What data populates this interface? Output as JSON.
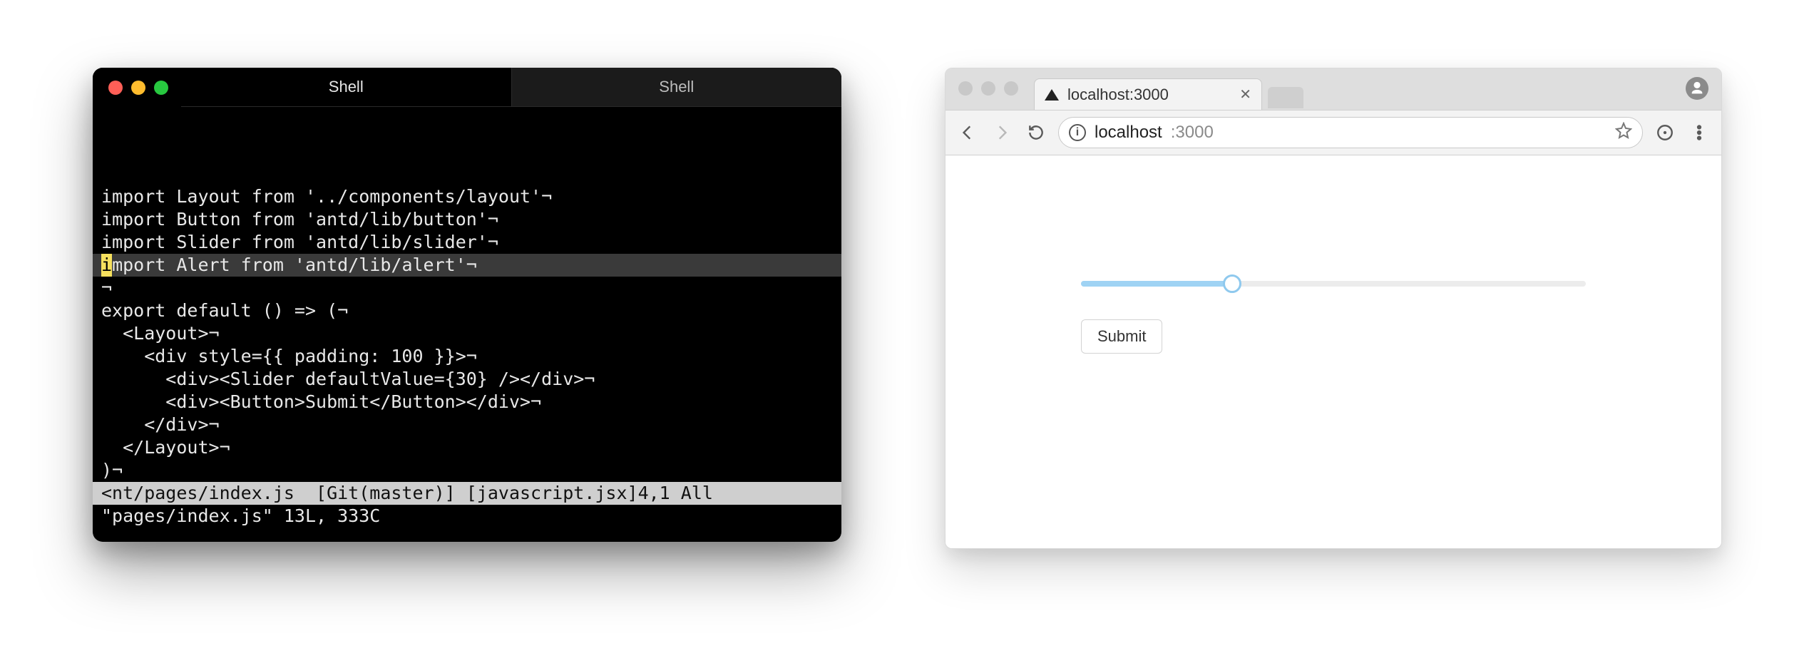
{
  "terminal": {
    "tabs": [
      {
        "label": "Shell",
        "active": true
      },
      {
        "label": "Shell",
        "active": false
      }
    ],
    "code_lines": [
      "import Layout from '../components/layout'¬",
      "import Button from 'antd/lib/button'¬",
      "import Slider from 'antd/lib/slider'¬",
      "import Alert from 'antd/lib/alert'¬",
      "¬",
      "export default () => (¬",
      "  <Layout>¬",
      "    <div style={{ padding: 100 }}>¬",
      "      <div><Slider defaultValue={30} /></div>¬",
      "      <div><Button>Submit</Button></div>¬",
      "    </div>¬",
      "  </Layout>¬",
      ")¬"
    ],
    "highlight_index": 3,
    "cursor": {
      "line": 3,
      "col": 0
    },
    "status_line": "<nt/pages/index.js  [Git(master)] [javascript.jsx]4,1 All",
    "message_line": "\"pages/index.js\" 13L, 333C"
  },
  "browser": {
    "tab": {
      "title": "localhost:3000"
    },
    "address": {
      "host": "localhost",
      "path": ":3000"
    },
    "slider": {
      "value": 30,
      "min": 0,
      "max": 100
    },
    "button_label": "Submit"
  }
}
